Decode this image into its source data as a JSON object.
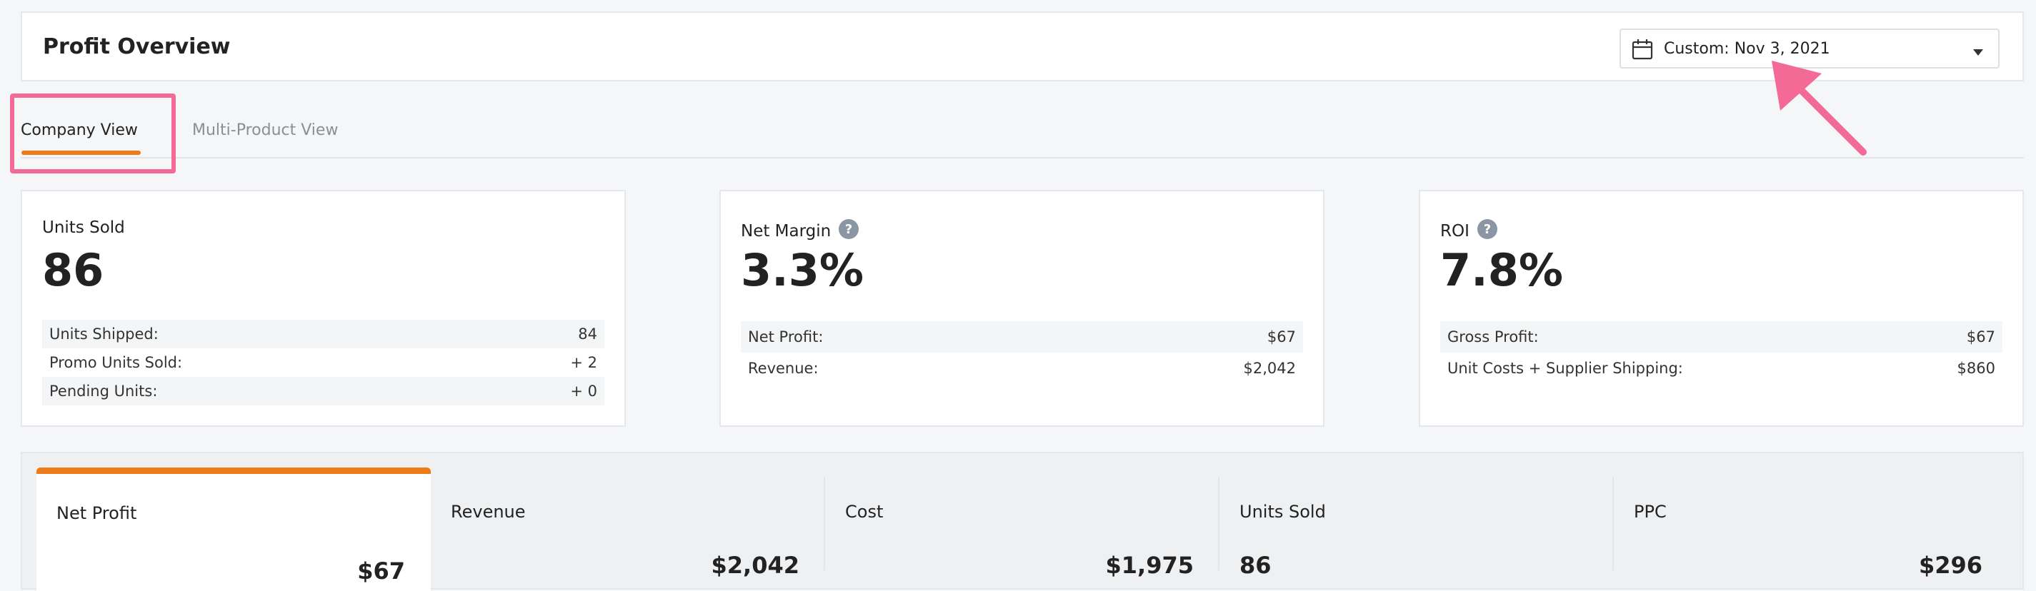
{
  "header": {
    "title": "Profit Overview",
    "date_picker": {
      "label": "Custom: Nov 3, 2021",
      "icon": "calendar-icon"
    }
  },
  "tabs": [
    {
      "label": "Company View",
      "active": true
    },
    {
      "label": "Multi-Product View",
      "active": false
    }
  ],
  "cards": {
    "units_sold": {
      "title": "Units Sold",
      "value": "86",
      "rows": [
        {
          "label": "Units Shipped:",
          "value": "84"
        },
        {
          "label": "Promo Units Sold:",
          "value": "+ 2"
        },
        {
          "label": "Pending Units:",
          "value": "+ 0"
        }
      ]
    },
    "net_margin": {
      "title": "Net Margin",
      "value": "3.3%",
      "rows": [
        {
          "label": "Net Profit:",
          "value": "$67"
        },
        {
          "label": "Revenue:",
          "value": "$2,042"
        }
      ]
    },
    "roi": {
      "title": "ROI",
      "value": "7.8%",
      "rows": [
        {
          "label": "Gross Profit:",
          "value": "$67"
        },
        {
          "label": "Unit Costs + Supplier Shipping:",
          "value": "$860"
        }
      ]
    }
  },
  "summary_tabs": [
    {
      "label": "Net Profit",
      "value": "$67"
    },
    {
      "label": "Revenue",
      "value": "$2,042"
    },
    {
      "label": "Cost",
      "value": "$1,975"
    },
    {
      "label": "Units Sold",
      "value": "86"
    },
    {
      "label": "PPC",
      "value": "$296"
    }
  ],
  "colors": {
    "accent": "#ef7a1a",
    "highlight": "#f36a96",
    "help_icon": "#8a96a3"
  }
}
